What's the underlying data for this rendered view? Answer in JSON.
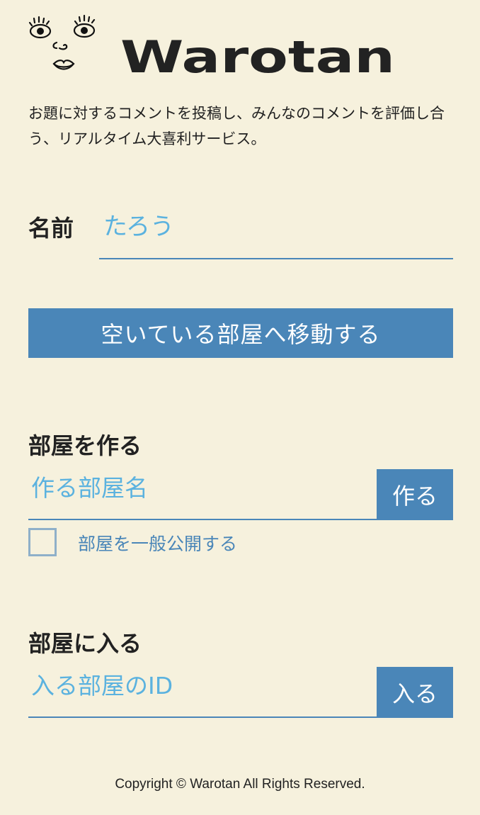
{
  "header": {
    "logo_icon": "face-icon",
    "wordmark": "Warotan"
  },
  "tagline": "お題に対するコメントを投稿し、みんなのコメントを評価し合う、リアルタイム大喜利サービス。",
  "name_section": {
    "label": "名前",
    "placeholder": "たろう",
    "value": ""
  },
  "random_room_button": "空いている部屋へ移動する",
  "create_room": {
    "title": "部屋を作る",
    "input_placeholder": "作る部屋名",
    "button_label": "作る",
    "public_checkbox_label": "部屋を一般公開する",
    "public_checked": false
  },
  "join_room": {
    "title": "部屋に入る",
    "input_placeholder": "入る部屋のID",
    "button_label": "入る"
  },
  "footer": {
    "copyright": "Copyright © Warotan All Rights Reserved."
  },
  "colors": {
    "background": "#f6f1dd",
    "accent": "#4a86b8",
    "placeholder": "#5bb2df"
  }
}
